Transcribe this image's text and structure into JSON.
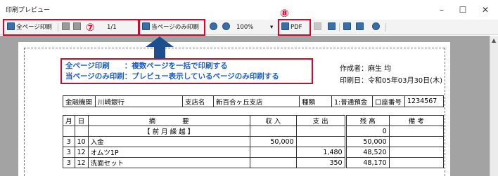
{
  "window": {
    "title": "印刷プレビュー",
    "minimize": "–",
    "maximize": "☐",
    "close": "✕"
  },
  "toolbar": {
    "print_all_label": "全ページ印刷",
    "page_counter": "1/1",
    "print_current_label": "当ページのみ印刷",
    "zoom": "100%",
    "zoom_caret": "▾",
    "pdf_label": "PDF",
    "callout_7": "⑦",
    "callout_8": "⑧"
  },
  "note": {
    "line1": "全ページ印刷　　：複数ページを一括で印刷する",
    "line2": "当ページのみ印刷：プレビュー表示しているページのみ印刷する"
  },
  "report": {
    "author": "作成者：麻生 均",
    "print_date": "印刷日：令和05年03月30日(木)",
    "bank": {
      "bank_label": "金融機関",
      "bank_value": "川崎銀行",
      "branch_label": "支店名",
      "branch_value": "新百合ヶ丘支店",
      "type_label": "種類",
      "type_value": "1:普通預金",
      "account_label": "口座番号",
      "account_value": "1234567"
    },
    "headers": {
      "month": "月",
      "day": "日",
      "desc": "摘　　　　要",
      "income": "収 入",
      "expense": "支 出",
      "balance": "残 高",
      "remarks": "備 考"
    },
    "rows": [
      {
        "month": "",
        "day": "",
        "desc": "【 前 月 繰 越 】",
        "income": "",
        "expense": "",
        "balance": "0",
        "remarks": ""
      },
      {
        "month": "3",
        "day": "10",
        "desc": "入金",
        "income": "50,000",
        "expense": "",
        "balance": "50,000",
        "remarks": ""
      },
      {
        "month": "3",
        "day": "12",
        "desc": "オムツ1P",
        "income": "",
        "expense": "1,480",
        "balance": "48,520",
        "remarks": ""
      },
      {
        "month": "3",
        "day": "12",
        "desc": "洗面セット",
        "income": "",
        "expense": "350",
        "balance": "48,170",
        "remarks": ""
      }
    ]
  },
  "scrollbar": {
    "up_arrow": "▲"
  }
}
